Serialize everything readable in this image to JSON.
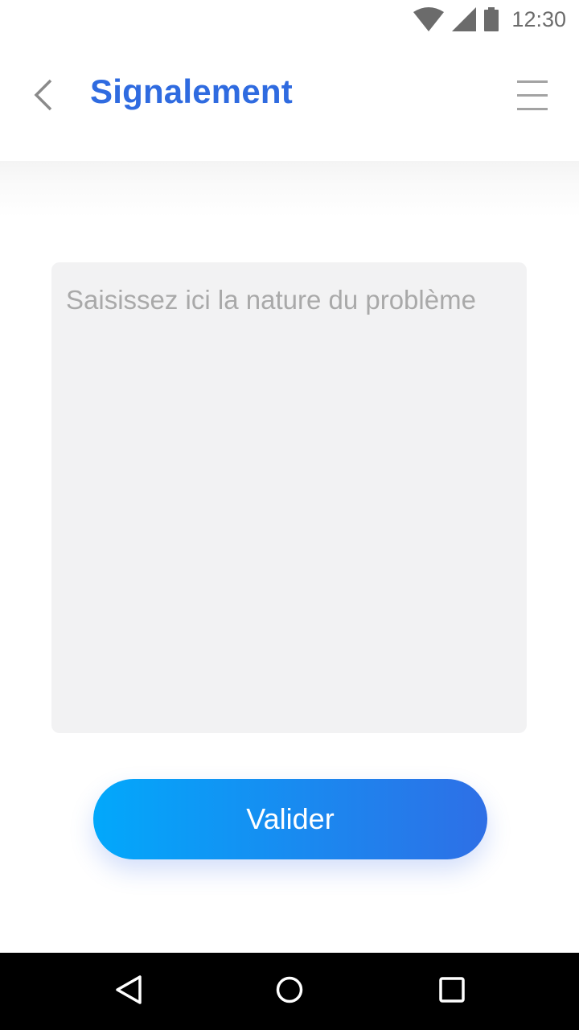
{
  "status_bar": {
    "time": "12:30",
    "icons": [
      "wifi-icon",
      "cellular-signal-icon",
      "battery-icon"
    ]
  },
  "header": {
    "title": "Signalement",
    "back_icon": "chevron-left-icon",
    "menu_icon": "hamburger-menu-icon"
  },
  "form": {
    "problem_placeholder": "Saisissez ici la nature du problème",
    "problem_value": "",
    "submit_label": "Valider"
  },
  "nav_bar": {
    "icons": [
      "nav-back-icon",
      "nav-home-icon",
      "nav-recents-icon"
    ]
  },
  "colors": {
    "title": "#2f6be0",
    "button_gradient_start": "#02a8fb",
    "button_gradient_end": "#2e6fe6",
    "input_background": "#f2f2f3",
    "placeholder": "#a9a9a9"
  }
}
